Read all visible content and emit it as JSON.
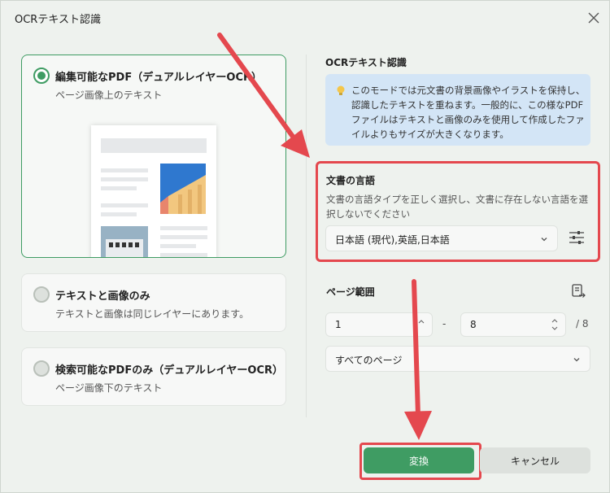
{
  "window": {
    "title": "OCRテキスト認識"
  },
  "options": [
    {
      "title": "編集可能なPDF（デュアルレイヤーOCR）",
      "subtitle": "ページ画像上のテキスト",
      "selected": true
    },
    {
      "title": "テキストと画像のみ",
      "subtitle": "テキストと画像は同じレイヤーにあります。",
      "selected": false
    },
    {
      "title": "検索可能なPDFのみ（デュアルレイヤーOCR）",
      "subtitle": "ページ画像下のテキスト",
      "selected": false
    }
  ],
  "ocr": {
    "section_title": "OCRテキスト認識",
    "info_text": "このモードでは元文書の背景画像やイラストを保持し、認識したテキストを重ねます。一般的に、この様なPDFファイルはテキストと画像のみを使用して作成したファイルよりもサイズが大きくなります。"
  },
  "language": {
    "section_title": "文書の言語",
    "description": "文書の言語タイプを正しく選択し、文書に存在しない言語を選択しないでください",
    "selected": "日本語 (現代),英語,日本語"
  },
  "page_range": {
    "section_title": "ページ範囲",
    "from": "1",
    "dash": "-",
    "to": "8",
    "total": "/ 8",
    "scope": "すべてのページ"
  },
  "buttons": {
    "convert": "変換",
    "cancel": "キャンセル"
  },
  "colors": {
    "accent_green": "#3f9c63",
    "highlight_red": "#e4484e",
    "info_bg": "#d3e5f6",
    "dialog_bg": "#eef2ee"
  },
  "icons": {
    "close": "close-icon",
    "bulb": "lightbulb-icon",
    "chevron": "chevron-down-icon",
    "settings": "sliders-icon",
    "page_range": "document-range-icon"
  }
}
